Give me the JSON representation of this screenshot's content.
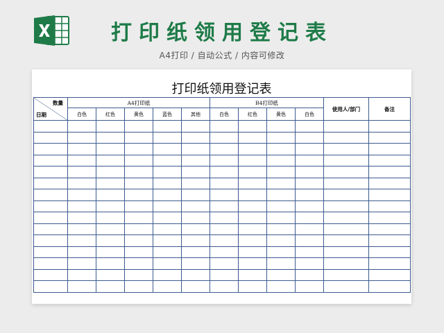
{
  "banner": {
    "logo_icon": "excel-icon",
    "title": "打印纸领用登记表",
    "subtitle": "A4打印 / 自动公式 / 内容可修改"
  },
  "sheet": {
    "title": "打印纸领用登记表",
    "corner_top": "数量",
    "corner_bottom": "日期",
    "group_a4": "A4打印纸",
    "group_b4": "B4打印纸",
    "user_dept": "使用人/部门",
    "remarks": "备注",
    "a4_colors": [
      "白色",
      "红色",
      "黄色",
      "蓝色",
      "其他"
    ],
    "b4_colors": [
      "白色",
      "红色",
      "黄色",
      "白色"
    ]
  },
  "colors": {
    "accent": "#1e7b48",
    "grid_line": "#3d5a8e",
    "background": "#ececec"
  }
}
